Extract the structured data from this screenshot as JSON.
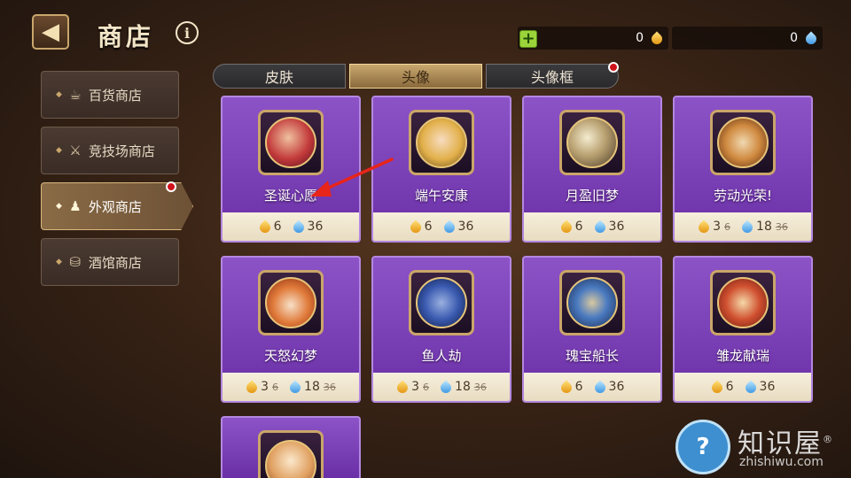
{
  "header": {
    "title": "商店",
    "info": "i",
    "gold_amount": "0",
    "water_amount": "0",
    "plus": "+"
  },
  "sidebar": {
    "items": [
      {
        "label": "百货商店",
        "icon": "mug-icon"
      },
      {
        "label": "竞技场商店",
        "icon": "crossed-swords-icon"
      },
      {
        "label": "外观商店",
        "icon": "dress-icon",
        "active": true
      },
      {
        "label": "酒馆商店",
        "icon": "barrel-icon"
      }
    ]
  },
  "tabs": [
    {
      "label": "皮肤"
    },
    {
      "label": "头像",
      "active": true
    },
    {
      "label": "头像框"
    }
  ],
  "cards": [
    {
      "name": "圣诞心愿",
      "gold": "6",
      "water": "36",
      "portrait_color": "#c23a3a"
    },
    {
      "name": "端午安康",
      "gold": "6",
      "water": "36",
      "portrait_color": "#e2b04a"
    },
    {
      "name": "月盈旧梦",
      "gold": "6",
      "water": "36",
      "portrait_color": "#7a6a4a"
    },
    {
      "name": "劳动光荣!",
      "gold": "3",
      "gold_old": "6",
      "water": "18",
      "water_old": "36",
      "portrait_color": "#b05a2a"
    },
    {
      "name": "天怒幻梦",
      "gold": "3",
      "gold_old": "6",
      "water": "18",
      "water_old": "36",
      "portrait_color": "#e07a3a"
    },
    {
      "name": "鱼人劫",
      "gold": "3",
      "gold_old": "6",
      "water": "18",
      "water_old": "36",
      "portrait_color": "#3a5ab0"
    },
    {
      "name": "瑰宝船长",
      "gold": "6",
      "water": "36",
      "portrait_color": "#4a7ac0"
    },
    {
      "name": "雏龙献瑞",
      "gold": "6",
      "water": "36",
      "portrait_color": "#d05030"
    },
    {
      "name": "",
      "portrait_color": "#e0a060"
    }
  ],
  "watermark": {
    "text": "知识屋",
    "registered": "®",
    "url": "zhishiwu.com",
    "icon": "question-screen-icon"
  },
  "colors": {
    "card_purple": "#7a3fb8",
    "active_gold": "#c9a86f",
    "notification_red": "#d0121a"
  }
}
